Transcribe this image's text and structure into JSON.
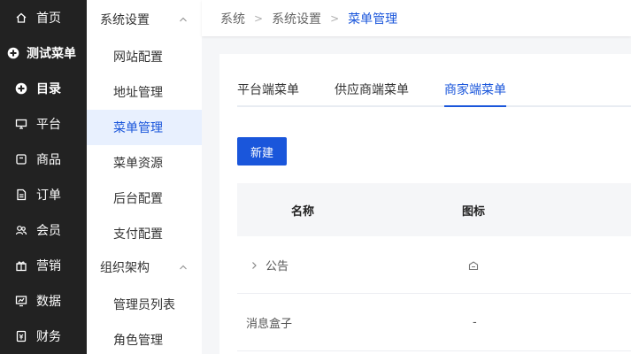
{
  "rail": {
    "items": [
      {
        "label": "首页",
        "icon": "home-icon"
      },
      {
        "label": "测试菜单",
        "icon": "circle-plus-icon"
      },
      {
        "label": "目录",
        "icon": "circle-plus-icon"
      },
      {
        "label": "平台",
        "icon": "monitor-icon"
      },
      {
        "label": "商品",
        "icon": "box-icon"
      },
      {
        "label": "订单",
        "icon": "document-icon"
      },
      {
        "label": "会员",
        "icon": "users-icon"
      },
      {
        "label": "营销",
        "icon": "gift-icon"
      },
      {
        "label": "数据",
        "icon": "chart-icon"
      },
      {
        "label": "财务",
        "icon": "finance-icon"
      }
    ]
  },
  "sidebar": {
    "groups": [
      {
        "label": "系统设置",
        "items": [
          "网站配置",
          "地址管理",
          "菜单管理",
          "菜单资源",
          "后台配置",
          "支付配置"
        ]
      },
      {
        "label": "组织架构",
        "items": [
          "管理员列表",
          "角色管理"
        ]
      }
    ],
    "active_item": "菜单管理"
  },
  "breadcrumb": {
    "items": [
      "系统",
      "系统设置"
    ],
    "current": "菜单管理"
  },
  "tabs": [
    {
      "label": "平台端菜单"
    },
    {
      "label": "供应商端菜单"
    },
    {
      "label": "商家端菜单"
    }
  ],
  "active_tab": "商家端菜单",
  "toolbar": {
    "new_label": "新建"
  },
  "table": {
    "columns": [
      "名称",
      "图标"
    ],
    "rows": [
      {
        "name": "公告",
        "icon": "notice-icon",
        "expandable": true
      },
      {
        "name": "消息盒子",
        "icon_text": "-",
        "expandable": false
      }
    ]
  },
  "colors": {
    "accent": "#1a56db",
    "rail_bg": "#222222",
    "active_bg": "#e8f0fe"
  }
}
